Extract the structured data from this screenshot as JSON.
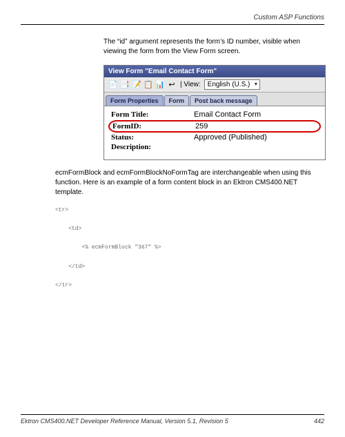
{
  "header": {
    "section_title": "Custom ASP Functions"
  },
  "paragraphs": {
    "p1": "The “id” argument represents the form’s ID number, visible when viewing the form from the View Form screen.",
    "p2": "ecmFormBlock and ecmFormBlockNoFormTag are interchangeable when using this function. Here is an example of a form content block in an Ektron CMS400.NET template."
  },
  "window": {
    "title": "View Form \"Email Contact Form\"",
    "toolbar": {
      "view_label": "| View:",
      "language": "English (U.S.)"
    },
    "tabs": [
      "Form Properties",
      "Form",
      "Post back message"
    ],
    "props": {
      "form_title": {
        "label": "Form Title:",
        "value": "Email Contact Form"
      },
      "form_id": {
        "label": "FormID:",
        "value": "259"
      },
      "status": {
        "label": "Status:",
        "value": "Approved (Published)"
      },
      "description": {
        "label": "Description:",
        "value": ""
      }
    }
  },
  "code": "<tr>\n\n    <td>\n\n        <% ecmFormBlock \"367\" %>\n\n    </td>\n\n</tr>",
  "footer": {
    "left": "Ektron CMS400.NET Developer Reference Manual, Version 5.1, Revision 5",
    "right": "442"
  }
}
